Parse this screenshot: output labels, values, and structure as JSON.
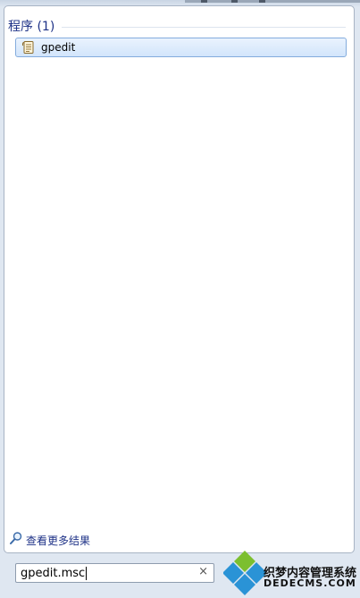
{
  "results": {
    "group_title": "程序 (1)",
    "items": [
      {
        "label": "gpedit",
        "icon": "document-icon"
      }
    ],
    "see_more_label": "查看更多结果"
  },
  "search": {
    "value": "gpedit.msc",
    "clear_symbol": "×"
  },
  "watermark": {
    "brand_text": "织梦内容管理系统",
    "brand_url": "DEDECMS.COM"
  },
  "colors": {
    "accent_text": "#1e3287",
    "selection_border": "#84acdd",
    "selection_fill": "#d2e5fb"
  }
}
